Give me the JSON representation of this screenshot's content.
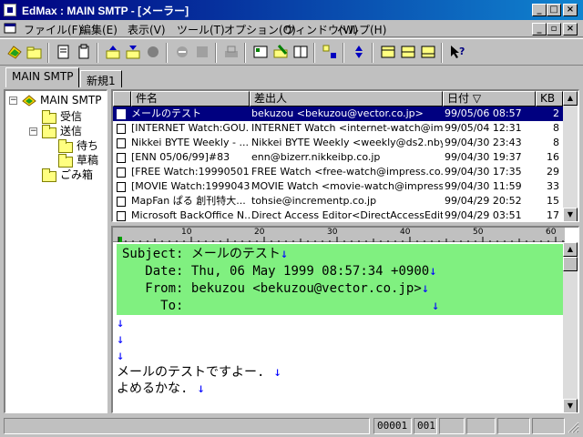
{
  "window": {
    "title": "EdMax : MAIN SMTP - [メーラー]"
  },
  "menu": {
    "items": [
      "ファイル(F)",
      "編集(E)",
      "表示(V)",
      "ツール(T)",
      "オプション(O)",
      "ウィンドウ(W)",
      "ヘルプ(H)"
    ]
  },
  "tabs": [
    "MAIN SMTP",
    "新規1"
  ],
  "tree": {
    "root": "MAIN SMTP",
    "inbox": "受信",
    "sent": "送信",
    "pending": "待ち",
    "drafts": "草稿",
    "trash": "ごみ箱"
  },
  "list": {
    "columns": [
      "件名",
      "差出人",
      "日付 ▽",
      "KB"
    ],
    "rows": [
      {
        "subject": "メールのテスト",
        "from": "bekuzou <bekuzou@vector.co.jp>",
        "date": "99/05/06 08:57",
        "kb": "2"
      },
      {
        "subject": "[INTERNET Watch:GOU...",
        "from": "INTERNET Watch <internet-watch@imp...",
        "date": "99/05/04 12:31",
        "kb": "8"
      },
      {
        "subject": "Nikkei BYTE Weekly - ...",
        "from": "Nikkei BYTE Weekly <weekly@ds2.nby...",
        "date": "99/04/30 23:43",
        "kb": "8"
      },
      {
        "subject": "[ENN 05/06/99]#83",
        "from": "enn@bizerr.nikkeibp.co.jp",
        "date": "99/04/30 19:37",
        "kb": "16"
      },
      {
        "subject": "[FREE Watch:19990501]",
        "from": "FREE Watch <free-watch@impress.co.j...",
        "date": "99/04/30 17:35",
        "kb": "29"
      },
      {
        "subject": "[MOVIE Watch:19990430]",
        "from": "MOVIE Watch <movie-watch@impress.c...",
        "date": "99/04/30 11:59",
        "kb": "33"
      },
      {
        "subject": "MapFan ぱる 創刊特大...",
        "from": "tohsie@incrementp.co.jp",
        "date": "99/04/29 20:52",
        "kb": "15"
      },
      {
        "subject": "Microsoft BackOffice N...",
        "from": "Direct Access Editor<DirectAccessEdit...",
        "date": "99/04/29 03:51",
        "kb": "17"
      }
    ]
  },
  "ruler": {
    "marks": [
      "10",
      "20",
      "30",
      "40",
      "50",
      "60"
    ]
  },
  "preview": {
    "headers": [
      {
        "label": "Subject:",
        "value": "メールのテスト"
      },
      {
        "label": "Date:",
        "value": "Thu, 06 May 1999 08:57:34 +0900"
      },
      {
        "label": "From:",
        "value": "bekuzou <bekuzou@vector.co.jp>"
      },
      {
        "label": "To:",
        "value": ""
      }
    ],
    "body": [
      "",
      "",
      "",
      "メールのテストですよー.",
      "よめるかな."
    ],
    "newline_mark": "↓"
  },
  "status": {
    "msg_no": "00001",
    "count": "001"
  },
  "colors": {
    "titlebar": "#000080",
    "header_bg": "#80f080",
    "newline_mark": "#0000ff",
    "selection": "#000080"
  }
}
